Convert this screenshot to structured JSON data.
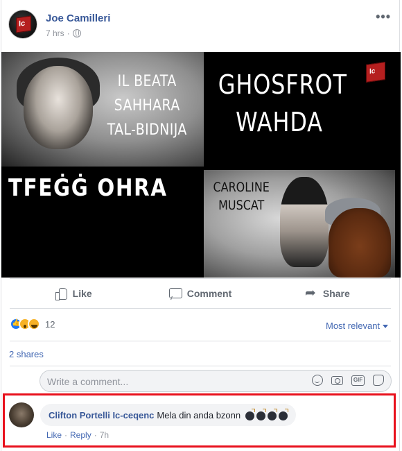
{
  "post": {
    "author": "Joe Camilleri",
    "time": "7 hrs",
    "meta_separator": "·",
    "avatar_logo_text": "lc",
    "more_icon": "more-dots-icon"
  },
  "image": {
    "panel_top_left_lines": [
      "IL BEATA",
      "SAHHARA",
      "TAL-BIDNIJA"
    ],
    "panel_top_right_lines": [
      "GHOSFROT",
      "WAHDA"
    ],
    "panel_middle_left": "TFEĠĠ  OHRA",
    "panel_bottom_right_lines": [
      "CAROLINE",
      "MUSCAT"
    ],
    "logo_text": "lc"
  },
  "actions": {
    "like": "Like",
    "comment": "Comment",
    "share": "Share"
  },
  "reactions": {
    "count": "12",
    "types": [
      "like",
      "wow",
      "haha"
    ],
    "sort": "Most relevant"
  },
  "shares": "2 shares",
  "comment_input": {
    "placeholder": "Write a comment..."
  },
  "comment": {
    "author": "Clifton Portelli Ic-ceqenc",
    "text": "Mela din anda bzonn",
    "emoji": [
      "bomb",
      "bomb",
      "bomb",
      "bomb"
    ],
    "like": "Like",
    "reply": "Reply",
    "time": "7h",
    "separator": "·"
  },
  "colors": {
    "link": "#385898",
    "highlight": "#e8101c",
    "reaction_like": "#2078f4",
    "reaction_emoji": "#f7b125"
  }
}
